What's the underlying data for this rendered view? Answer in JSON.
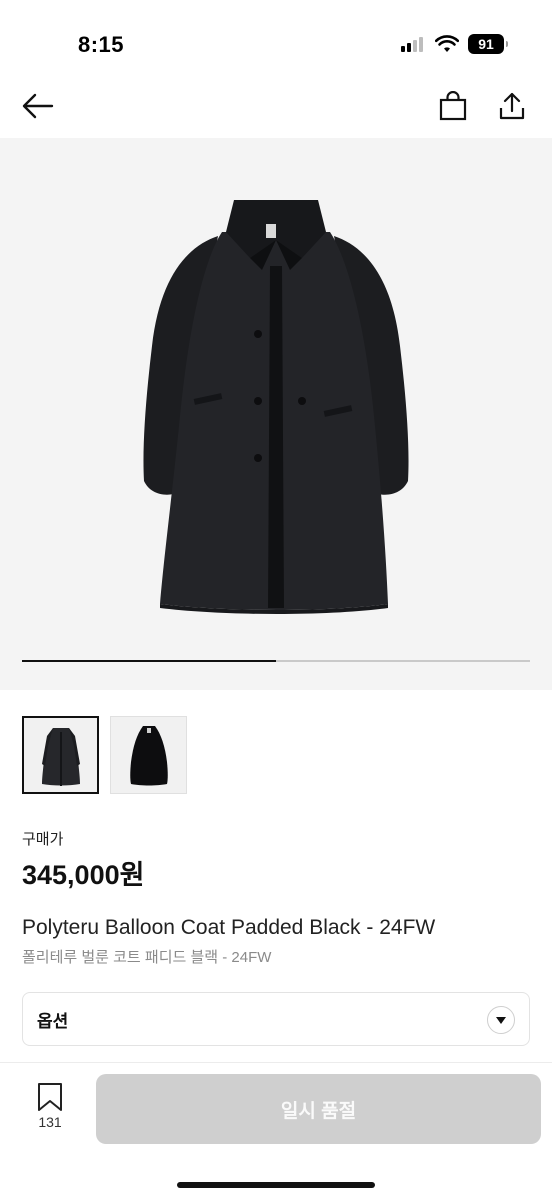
{
  "status_bar": {
    "time": "8:15",
    "battery": "91",
    "icons": [
      "signal-icon",
      "wifi-icon",
      "battery-icon"
    ]
  },
  "nav": {
    "icons": [
      "back-arrow-icon",
      "shopping-bag-icon",
      "share-icon"
    ]
  },
  "gallery": {
    "image_alt": "black balloon coat product photo",
    "progress_fraction": 0.5
  },
  "thumbnails": [
    {
      "name": "thumbnail-1",
      "selected": true
    },
    {
      "name": "thumbnail-2",
      "selected": false
    }
  ],
  "product": {
    "price_label": "구매가",
    "price": "345,000원",
    "name": "Polyteru Balloon Coat Padded Black - 24FW",
    "name_ko": "폴리테루 벌룬 코트 패디드 블랙 - 24FW"
  },
  "option": {
    "label": "옵션",
    "icon": "chevron-down-icon"
  },
  "bottom_bar": {
    "like_count": "131",
    "buy_label": "일시 품절"
  },
  "colors": {
    "accent": "#111111",
    "disabled_button": "#cfcfcf",
    "gallery_bg": "#f4f4f4"
  }
}
